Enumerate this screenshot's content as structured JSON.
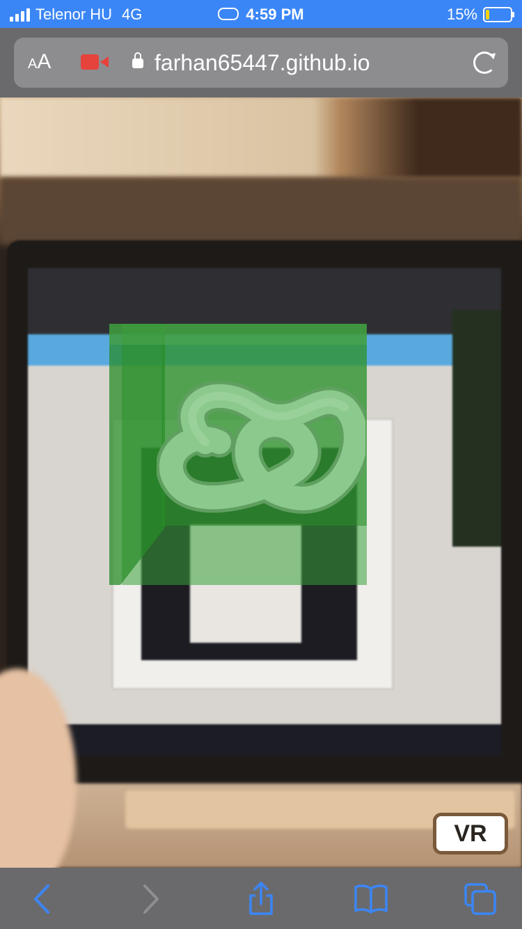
{
  "status": {
    "carrier": "Telenor HU",
    "network": "4G",
    "time": "4:59 PM",
    "battery_percent": "15%",
    "battery_level": 0.15,
    "signal_bars": 4
  },
  "address_bar": {
    "text_size_label": "AA",
    "url": "farhan65447.github.io",
    "camera_indicator_color": "#e5433c",
    "icons": [
      "text-size-icon",
      "camera-in-use-icon",
      "lock-icon",
      "reload-icon"
    ]
  },
  "ar_scene": {
    "vr_button_label": "VR",
    "overlay_color": "#3aa83a"
  },
  "toolbar": {
    "icons": [
      "back-icon",
      "forward-icon",
      "share-icon",
      "bookmarks-icon",
      "tabs-icon"
    ],
    "accent_color": "#3b86f6"
  }
}
